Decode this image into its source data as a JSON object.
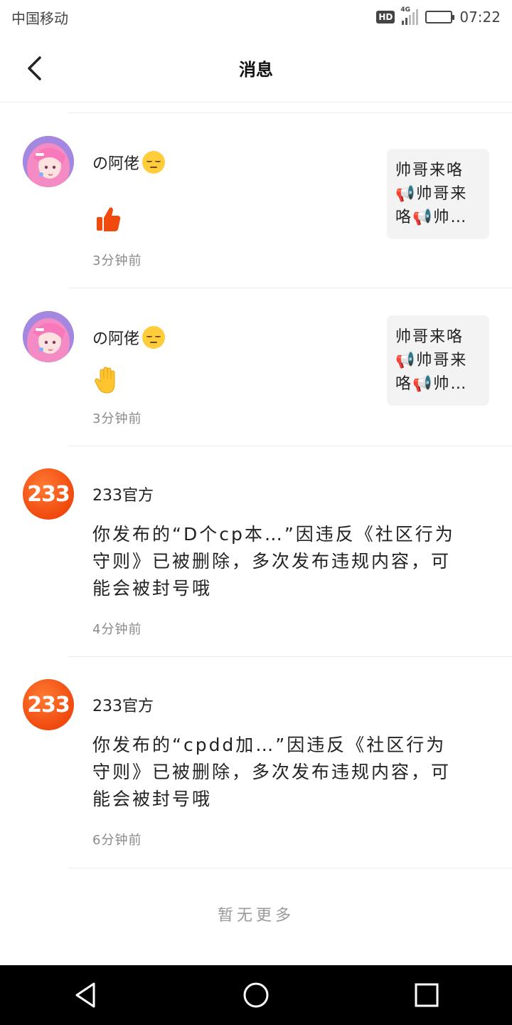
{
  "status_bar": {
    "carrier": "中国移动",
    "hd_badge": "HD",
    "network": "4G",
    "time": "07:22",
    "icons": [
      "hd-icon",
      "signal-icon",
      "battery-icon"
    ]
  },
  "header": {
    "title": "消息",
    "back_icon": "back-arrow-icon"
  },
  "messages": [
    {
      "user": "の阿佬",
      "user_emoji": "pensive-face",
      "reaction": "thumbs-up",
      "time": "3分钟前",
      "preview_text": [
        "帅哥来咯",
        "📢帅哥来",
        "咯📢帅…"
      ]
    },
    {
      "user": "の阿佬",
      "user_emoji": "pensive-face",
      "reaction": "raised-hand",
      "time": "3分钟前",
      "preview_text": [
        "帅哥来咯",
        "📢帅哥来",
        "咯📢帅…"
      ]
    },
    {
      "user": "233官方",
      "avatar_text": "233",
      "text": "你发布的“D个cp本…”因违反《社区行为守则》已被删除，多次发布违规内容，可能会被封号哦",
      "time": "4分钟前"
    },
    {
      "user": "233官方",
      "avatar_text": "233",
      "text": "你发布的“cpdd加…”因违反《社区行为守则》已被删除，多次发布违规内容，可能会被封号哦",
      "time": "6分钟前"
    }
  ],
  "footer": {
    "no_more": "暂无更多"
  },
  "nav_bar": {
    "icons": [
      "back-triangle-icon",
      "home-circle-icon",
      "recents-square-icon"
    ]
  },
  "colors": {
    "accent": "#f04a0f",
    "preview_bg": "#f3f3f3",
    "muted_text": "#8a8a8a"
  }
}
